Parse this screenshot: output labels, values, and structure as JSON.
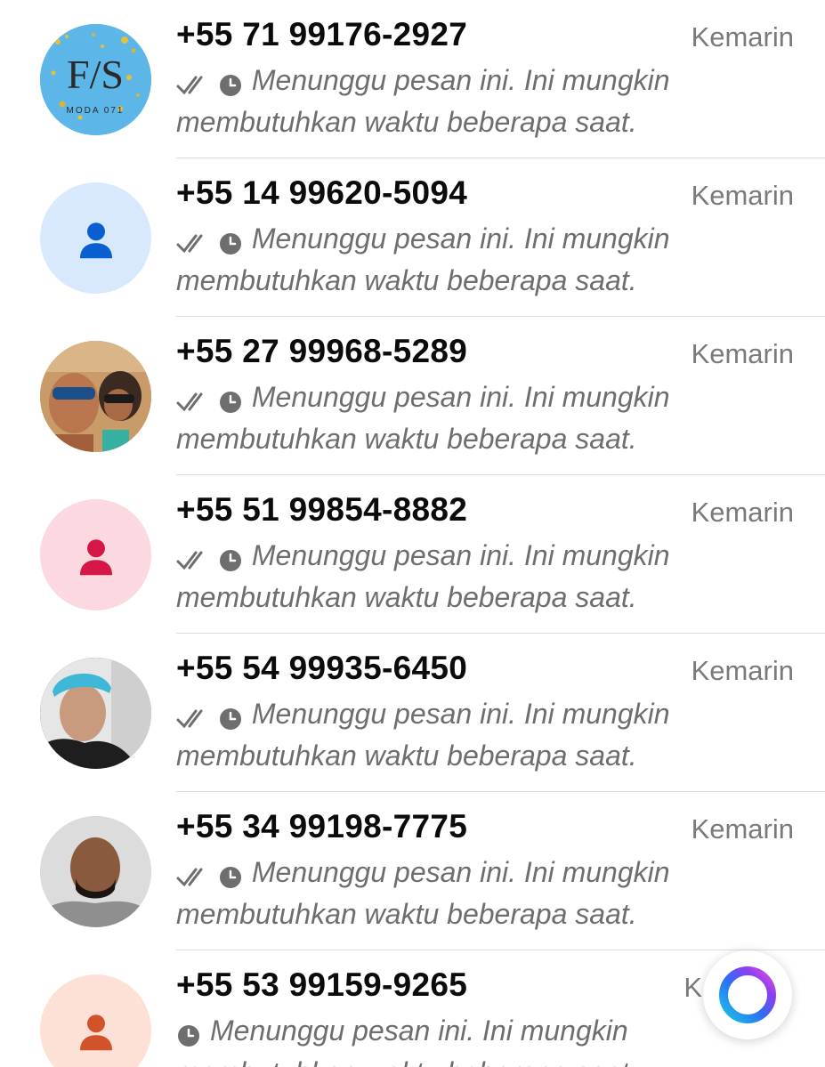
{
  "chats": [
    {
      "name": "+55 71 99176-2927",
      "time": "Kemarin",
      "preview": "Menunggu pesan ini. Ini mungkin membutuhkan waktu beberapa saat.",
      "avatar": "photo-logo",
      "double_tick": true
    },
    {
      "name": "+55 14 99620-5094",
      "time": "Kemarin",
      "preview": "Menunggu pesan ini. Ini mungkin membutuhkan waktu beberapa saat.",
      "avatar": "placeholder-blue",
      "double_tick": true
    },
    {
      "name": "+55 27 99968-5289",
      "time": "Kemarin",
      "preview": "Menunggu pesan ini. Ini mungkin membutuhkan waktu beberapa saat.",
      "avatar": "photo-beach",
      "double_tick": true
    },
    {
      "name": "+55 51 99854-8882",
      "time": "Kemarin",
      "preview": "Menunggu pesan ini. Ini mungkin membutuhkan waktu beberapa saat.",
      "avatar": "placeholder-pink",
      "double_tick": true
    },
    {
      "name": "+55 54 99935-6450",
      "time": "Kemarin",
      "preview": "Menunggu pesan ini. Ini mungkin membutuhkan waktu beberapa saat.",
      "avatar": "photo-cap",
      "double_tick": true
    },
    {
      "name": "+55 34 99198-7775",
      "time": "Kemarin",
      "preview": "Menunggu pesan ini. Ini mungkin membutuhkan waktu beberapa saat.",
      "avatar": "photo-man",
      "double_tick": true
    },
    {
      "name": "+55 53 99159-9265",
      "time": "K",
      "preview": "Menunggu pesan ini. Ini mungkin membutuhkan waktu beberapa saat.",
      "avatar": "placeholder-peach",
      "double_tick": false
    }
  ],
  "logo_text": "MODA 071",
  "colors": {
    "placeholder_blue_bg": "#d8e9fd",
    "placeholder_blue_icon": "#0a5fd0",
    "placeholder_pink_bg": "#fcd9e0",
    "placeholder_pink_icon": "#d41746",
    "placeholder_peach_bg": "#fde0d6",
    "placeholder_peach_icon": "#d2532a",
    "logo_bg": "#5cb6e8",
    "status_icon": "#6e6e6e"
  },
  "fab_icon": "meta-ai-ring-icon"
}
